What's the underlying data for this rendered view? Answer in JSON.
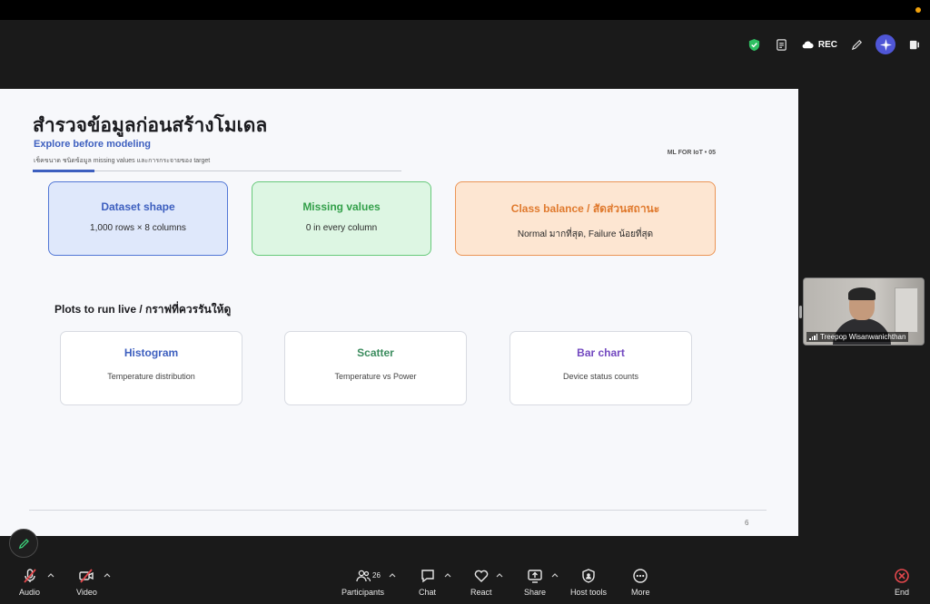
{
  "toolbar": {
    "rec_label": "REC"
  },
  "slide": {
    "title": "สำรวจข้อมูลก่อนสร้างโมเดล",
    "subtitle": "Explore before modeling",
    "small_text": "เช็คขนาด ชนิดข้อมูล missing values และการกระจายของ target",
    "tag": "ML FOR IoT • 05",
    "cards": [
      {
        "title": "Dataset shape",
        "desc": "1,000 rows × 8 columns"
      },
      {
        "title": "Missing values",
        "desc": "0 in every column"
      },
      {
        "title": "Class balance / สัดส่วนสถานะ",
        "desc": "Normal มากที่สุด, Failure น้อยที่สุด"
      }
    ],
    "plots_heading": "Plots to run live / กราฟที่ควรรันให้ดู",
    "plots": [
      {
        "title": "Histogram",
        "desc": "Temperature distribution"
      },
      {
        "title": "Scatter",
        "desc": "Temperature vs Power"
      },
      {
        "title": "Bar chart",
        "desc": "Device status counts"
      }
    ],
    "page_number": "6"
  },
  "video": {
    "name": "Treepop Wisanwanichthan"
  },
  "bottom_bar": {
    "audio": "Audio",
    "video": "Video",
    "participants": "Participants",
    "participants_count": "26",
    "chat": "Chat",
    "react": "React",
    "share": "Share",
    "host_tools": "Host tools",
    "more": "More",
    "end": "End"
  },
  "colors": {
    "accent_blue": "#3d5fbf",
    "green": "#33a04a",
    "orange": "#e07a2e",
    "purple": "#7349c0",
    "end_red": "#e5484d"
  }
}
